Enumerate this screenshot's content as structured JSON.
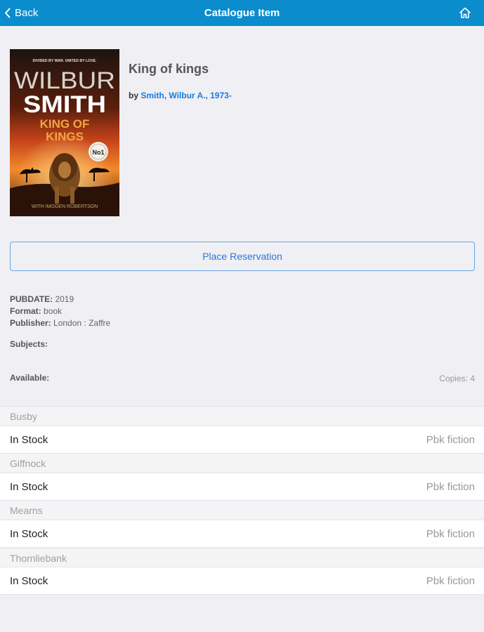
{
  "navbar": {
    "back_label": "Back",
    "title": "Catalogue Item"
  },
  "book": {
    "title": "King of kings",
    "by_label": "by",
    "author": "Smith, Wilbur A., 1973-",
    "cover": {
      "tagline": "DIVIDED BY WAR. UNITED BY LOVE.",
      "author_first": "WILBUR",
      "author_last": "SMITH",
      "title_line1": "KING OF",
      "title_line2": "KINGS",
      "badge": "No1",
      "coauthor": "WITH IMOGEN ROBERTSON"
    }
  },
  "actions": {
    "reserve_label": "Place Reservation"
  },
  "details": {
    "pubdate_label": "PUBDATE:",
    "pubdate_value": "2019",
    "format_label": "Format:",
    "format_value": "book",
    "publisher_label": "Publisher:",
    "publisher_value": "London : Zaffre",
    "subjects_label": "Subjects:",
    "available_label": "Available:",
    "copies_label": "Copies: 4"
  },
  "branches": [
    {
      "name": "Busby",
      "status": "In Stock",
      "shelf": "Pbk fiction"
    },
    {
      "name": "Giffnock",
      "status": "In Stock",
      "shelf": "Pbk fiction"
    },
    {
      "name": "Mearns",
      "status": "In Stock",
      "shelf": "Pbk fiction"
    },
    {
      "name": "Thornliebank",
      "status": "In Stock",
      "shelf": "Pbk fiction"
    }
  ],
  "colors": {
    "navbar": "#0a8ccd",
    "link": "#1a7be0",
    "background": "#efeff4"
  }
}
